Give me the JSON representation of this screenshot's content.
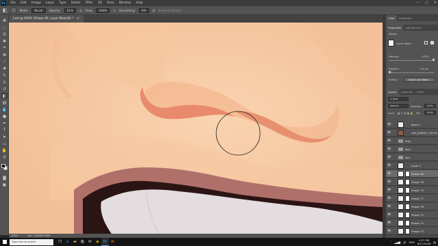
{
  "menubar": {
    "logo": "Ps",
    "items": [
      "File",
      "Edit",
      "Image",
      "Layer",
      "Type",
      "Select",
      "Filter",
      "3D",
      "View",
      "Window",
      "Help"
    ],
    "window_controls": [
      "—",
      "▢",
      "✕"
    ]
  },
  "options": {
    "mode_label": "Mode:",
    "mode_value": "Brush",
    "opacity_label": "Opacity:",
    "opacity_value": "51%",
    "flow_label": "Flow:",
    "flow_value": "100%",
    "smoothing_label": "Smoothing:",
    "smoothing_value": "0%",
    "erase_history": "Erase to History"
  },
  "document": {
    "tab_title": "Lest @ 200% (Shape 46, Layer Mask/8) *",
    "tab_close": "×",
    "zoom": "200%",
    "doc_size": "Doc: 26.8M/2.95M"
  },
  "panels": {
    "top_tabs": [
      "Color",
      "Swatches"
    ],
    "properties_tabs": [
      "Properties",
      "Adjustments"
    ],
    "masks_label": "Masks",
    "layer_mask_label": "Layer Mask",
    "density_label": "Density:",
    "density_value": "100%",
    "feather_label": "Feather:",
    "feather_value": "0.0 px",
    "refine_label": "Refine:",
    "select_mask_button": "Select and Mask...",
    "layers_tabs": [
      "Layers",
      "Channels",
      "Paths"
    ],
    "kind_label": "Kind",
    "blend_mode": "Normal",
    "opacity_label": "Opacity:",
    "opacity_value": "100%",
    "lock_label": "Lock:",
    "fill_label": "Fill:",
    "fill_value": "100%"
  },
  "layers": [
    {
      "name": "Mask 1",
      "type": "layer",
      "selected": false
    },
    {
      "name": "LIM_SUNSET_20170104...",
      "type": "photo",
      "selected": false
    },
    {
      "name": "frog",
      "type": "group",
      "selected": false
    },
    {
      "name": "face",
      "type": "group",
      "selected": false
    },
    {
      "name": "skin",
      "type": "group",
      "selected": false
    },
    {
      "name": "Layer 1",
      "type": "layer",
      "selected": false
    },
    {
      "name": "Shape 46",
      "type": "shape",
      "selected": true
    },
    {
      "name": "Shape 78",
      "type": "shape",
      "selected": false
    },
    {
      "name": "Shape 79",
      "type": "shape",
      "selected": false
    },
    {
      "name": "Shape 77",
      "type": "shape",
      "selected": false
    },
    {
      "name": "Shape 76",
      "type": "shape",
      "selected": false
    },
    {
      "name": "Shape 75",
      "type": "shape",
      "selected": false
    },
    {
      "name": "Shape 74",
      "type": "shape",
      "selected": false
    },
    {
      "name": "Shape 73",
      "type": "shape",
      "selected": false
    }
  ],
  "taskbar": {
    "search_placeholder": "Type here to search",
    "apps": [
      "task-view-icon",
      "edge-icon",
      "explorer-icon",
      "store-icon",
      "mail-icon",
      "chrome-icon",
      "photoshop-icon",
      "illustrator-icon"
    ],
    "language": "ENG",
    "time": "4:57 PM",
    "date": "8/17/2018"
  },
  "colors": {
    "skin": "#f7c9a1",
    "nostril": "#e7836a",
    "lip": "#b0706a",
    "teeth": "#e3dde0",
    "mouth_dark": "#2a1514"
  }
}
